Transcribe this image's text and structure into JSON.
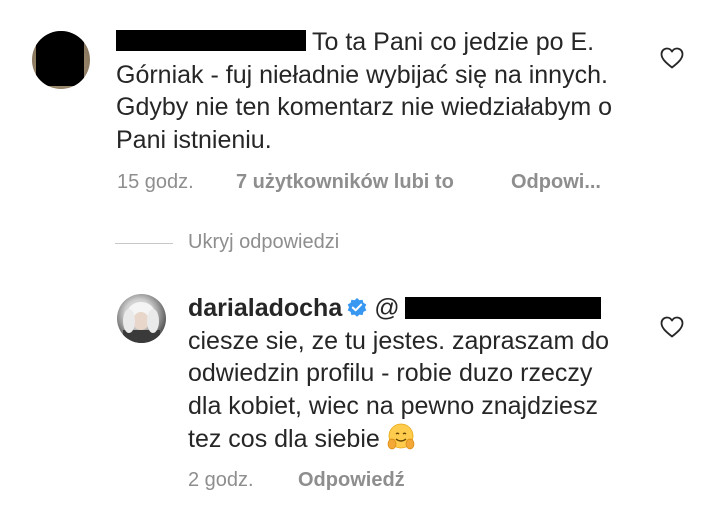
{
  "comment": {
    "text": "To ta Pani co jedzie po E. Górniak - fuj nieładnie wybijać się na innych. Gdyby nie ten komentarz nie wiedziałabym o Pani istnieniu.",
    "time": "15 godz.",
    "likes": "7 użytkowników lubi to",
    "reply_label": "Odpowi..."
  },
  "hide_replies": "Ukryj odpowiedzi",
  "reply": {
    "username": "darialadocha",
    "mention_prefix": "@",
    "text": "ciesze sie, ze tu jestes. zapraszam do odwiedzin profilu - robie duzo rzeczy dla kobiet, wiec na pewno znajdziesz tez cos dla siebie",
    "time": "2 godz.",
    "reply_label": "Odpowiedź"
  },
  "icons": {
    "like": "heart-outline-icon",
    "verified": "verified-badge-icon",
    "emoji": "hugging-face-emoji"
  },
  "colors": {
    "text": "#262626",
    "muted": "#8e8e8e",
    "verified": "#3897f0",
    "censor": "#000000"
  }
}
